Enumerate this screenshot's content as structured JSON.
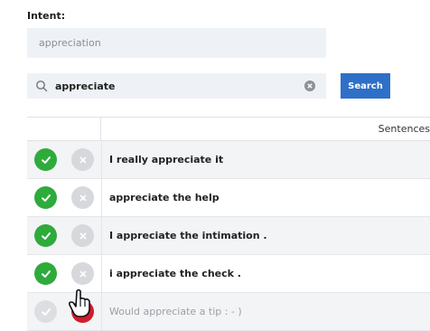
{
  "intent": {
    "label": "Intent:",
    "value": "appreciation"
  },
  "search": {
    "query": "appreciate",
    "button_label": "Search",
    "icon": "search-icon",
    "clear_icon": "clear-icon"
  },
  "table": {
    "column_header": "Sentences",
    "rows": [
      {
        "text": "I really appreciate it",
        "state": "accepted"
      },
      {
        "text": "appreciate the help",
        "state": "accepted"
      },
      {
        "text": "I appreciate the intimation .",
        "state": "accepted"
      },
      {
        "text": "i appreciate the check .",
        "state": "accepted"
      },
      {
        "text": "Would appreciate a tip : - )",
        "state": "rejected"
      }
    ]
  },
  "colors": {
    "accept": "#2eab3b",
    "reject": "#d21b2c",
    "primary_button": "#2e6fc8",
    "input_bg": "#eef2f7"
  }
}
